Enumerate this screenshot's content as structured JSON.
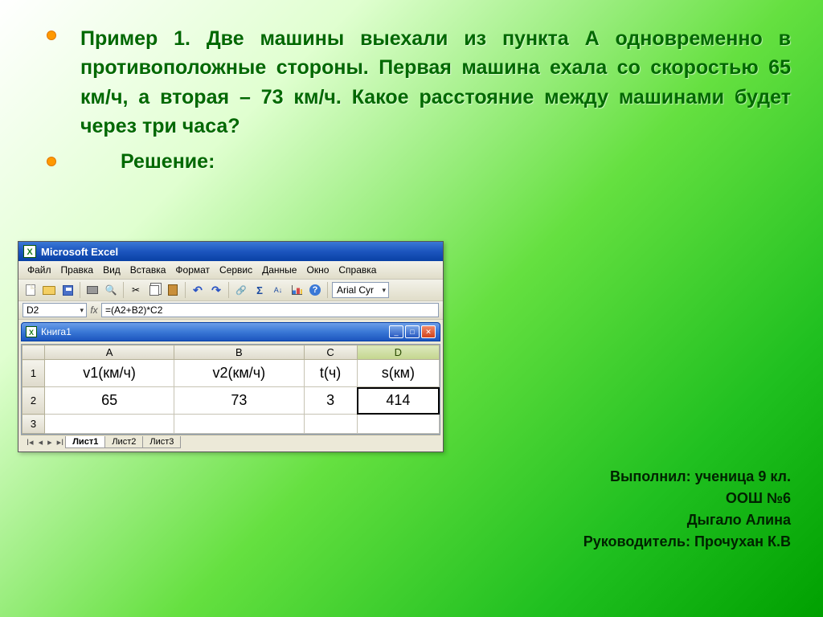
{
  "problem_text_lines": "        Пример 1. Две машины выехали из пункта А одновременно в противоположные стороны. Первая машина ехала со скоростью 65 км/ч, а вторая – 73 км/ч. Какое расстояние между машинами будет через три часа?",
  "solution_label": "Решение:",
  "excel": {
    "app_title": "Microsoft Excel",
    "menu": [
      "Файл",
      "Правка",
      "Вид",
      "Вставка",
      "Формат",
      "Сервис",
      "Данные",
      "Окно",
      "Справка"
    ],
    "font_name": "Arial Cyr",
    "name_box": "D2",
    "formula": "=(A2+B2)*C2",
    "workbook_title": "Книга1",
    "columns": [
      "A",
      "B",
      "C",
      "D"
    ],
    "headers": [
      "v1(км/ч)",
      "v2(км/ч)",
      "t(ч)",
      "s(км)"
    ],
    "values": [
      "65",
      "73",
      "3",
      "414"
    ],
    "sheets": [
      "Лист1",
      "Лист2",
      "Лист3"
    ]
  },
  "credits": {
    "l1": "Выполнил: ученица 9 кл.",
    "l2": "ООШ №6",
    "l3": "Дыгало Алина",
    "l4": "Руководитель: Прочухан К.В"
  },
  "chart_data": {
    "type": "table",
    "columns": [
      "v1(км/ч)",
      "v2(км/ч)",
      "t(ч)",
      "s(км)"
    ],
    "rows": [
      [
        65,
        73,
        3,
        414
      ]
    ],
    "formula": "=(A2+B2)*C2",
    "title": "Книга1"
  }
}
